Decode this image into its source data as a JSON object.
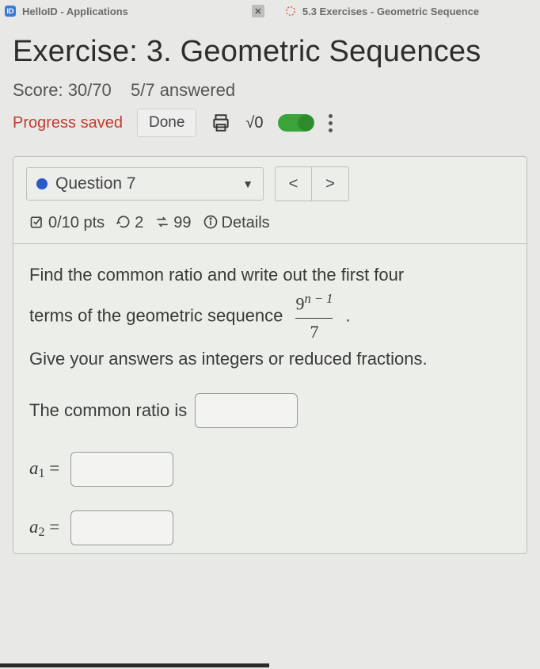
{
  "tabs": {
    "tab1": {
      "label": "HelloID - Applications"
    },
    "tab2": {
      "label": "5.3 Exercises - Geometric Sequence"
    }
  },
  "header": {
    "title": "Exercise: 3. Geometric Sequences",
    "score_label": "Score: 30/70",
    "answered_label": "5/7 answered",
    "progress_saved": "Progress saved",
    "done_label": "Done",
    "sqrt_badge": "√0"
  },
  "question": {
    "selector_label": "Question 7",
    "points": "0/10 pts",
    "retries": "2",
    "attempts": "99",
    "details_label": "Details",
    "prompt_line1": "Find the common ratio and write out the first four",
    "prompt_line2a": "terms of the geometric sequence ",
    "prompt_line2b": ".",
    "frac_num_base": "9",
    "frac_num_exp": "n − 1",
    "frac_den": "7",
    "prompt_line3": "Give your answers as integers or reduced fractions.",
    "common_ratio_label": "The common ratio is",
    "terms": [
      "a",
      "a"
    ],
    "term_subs": [
      "1",
      "2"
    ]
  }
}
